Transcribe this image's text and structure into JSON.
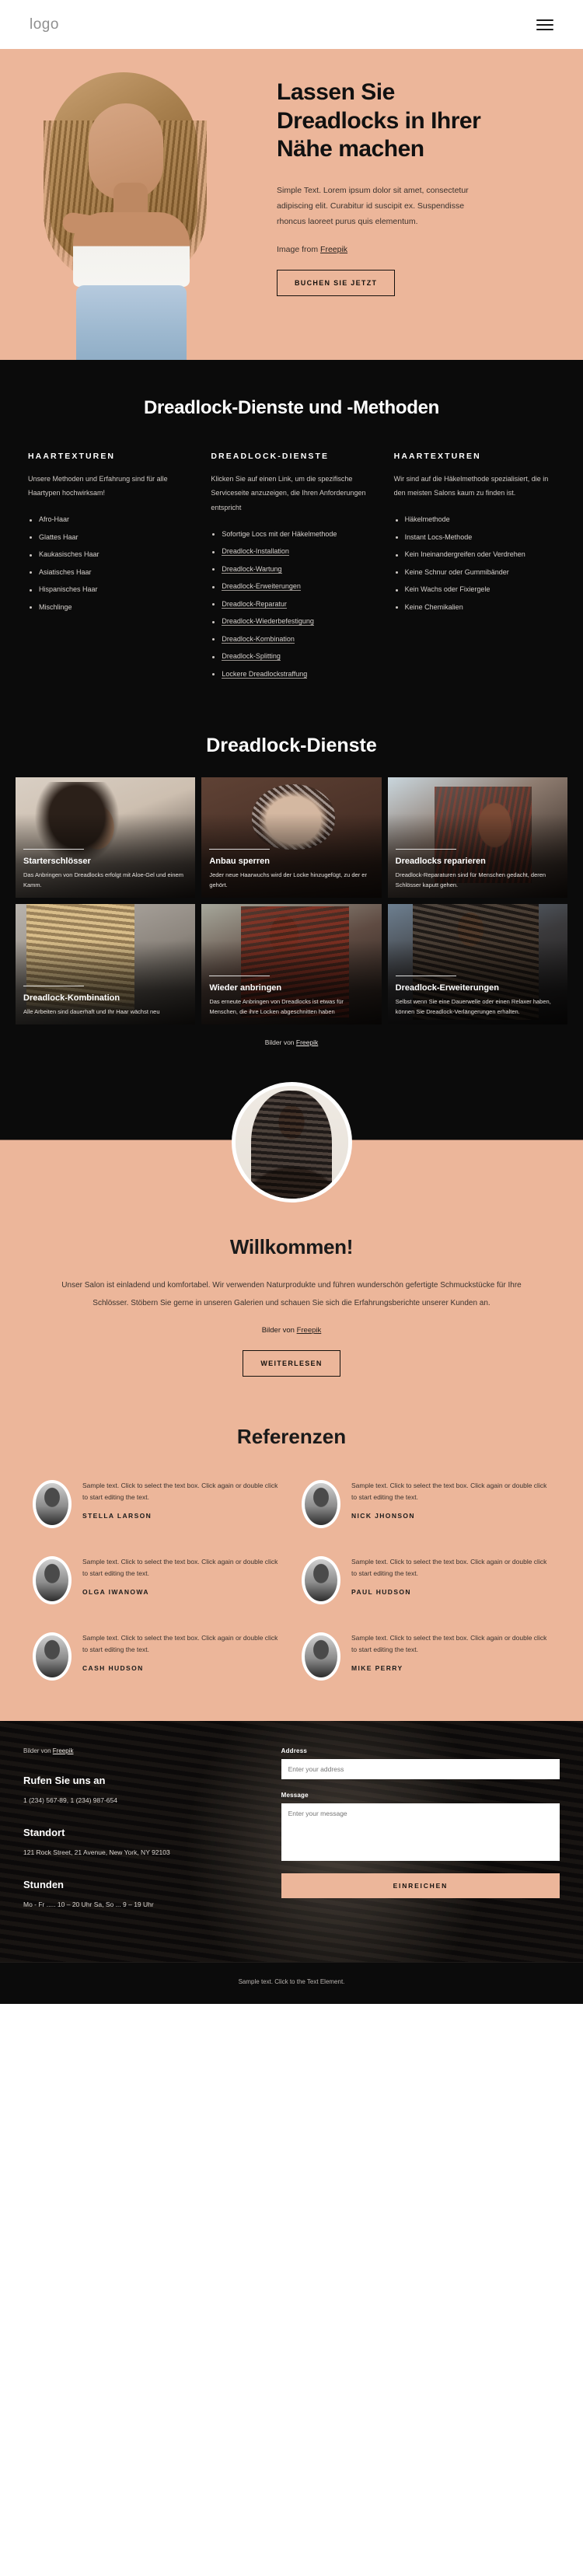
{
  "header": {
    "logo": "logo",
    "menu_icon": "hamburger-menu-icon"
  },
  "hero": {
    "title": "Lassen Sie Dreadlocks in Ihrer Nähe machen",
    "body": "Simple Text. Lorem ipsum dolor sit amet, consectetur adipiscing elit. Curabitur id suscipit ex. Suspendisse rhoncus laoreet purus quis elementum.",
    "credit_prefix": "Image from ",
    "credit_link": "Freepik",
    "cta": "BUCHEN SIE JETZT"
  },
  "methods": {
    "title": "Dreadlock-Dienste und -Methoden",
    "columns": [
      {
        "heading": "HAARTEXTUREN",
        "paragraph": "Unsere Methoden und Erfahrung sind für alle Haartypen hochwirksam!",
        "items": [
          {
            "label": "Afro-Haar",
            "link": false
          },
          {
            "label": "Glattes Haar",
            "link": false
          },
          {
            "label": "Kaukasisches Haar",
            "link": false
          },
          {
            "label": "Asiatisches Haar",
            "link": false
          },
          {
            "label": "Hispanisches Haar",
            "link": false
          },
          {
            "label": "Mischlinge",
            "link": false
          }
        ]
      },
      {
        "heading": "DREADLOCK-DIENSTE",
        "paragraph": "Klicken Sie auf einen Link, um die spezifische Serviceseite anzuzeigen, die Ihren Anforderungen entspricht",
        "items": [
          {
            "label": "Sofortige Locs mit der Häkelmethode",
            "link": false
          },
          {
            "label": "Dreadlock-Installation",
            "link": true
          },
          {
            "label": "Dreadlock-Wartung",
            "link": true
          },
          {
            "label": "Dreadlock-Erweiterungen",
            "link": true
          },
          {
            "label": "Dreadlock-Reparatur",
            "link": true
          },
          {
            "label": "Dreadlock-Wiederbefestigung",
            "link": true
          },
          {
            "label": "Dreadlock-Kombination",
            "link": true
          },
          {
            "label": "Dreadlock-Splitting",
            "link": true
          },
          {
            "label": "Lockere Dreadlockstraffung",
            "link": true
          }
        ]
      },
      {
        "heading": "HAARTEXTUREN",
        "paragraph": "Wir sind auf die Häkelmethode spezialisiert, die in den meisten Salons kaum zu finden ist.",
        "items": [
          {
            "label": "Häkelmethode",
            "link": false
          },
          {
            "label": "Instant Locs-Methode",
            "link": false
          },
          {
            "label": "Kein Ineinandergreifen oder Verdrehen",
            "link": false
          },
          {
            "label": "Keine Schnur oder Gummibänder",
            "link": false
          },
          {
            "label": "Kein Wachs oder Fixiergele",
            "link": false
          },
          {
            "label": "Keine Chemikalien",
            "link": false
          }
        ]
      }
    ]
  },
  "gallery": {
    "title": "Dreadlock-Dienste",
    "cards": [
      {
        "title": "Starterschlösser",
        "text": "Das Anbringen von Dreadlocks erfolgt mit Aloe-Gel und einem Kamm."
      },
      {
        "title": "Anbau sperren",
        "text": "Jeder neue Haarwuchs wird der Locke hinzugefügt, zu der er gehört."
      },
      {
        "title": "Dreadlocks reparieren",
        "text": "Dreadlock-Reparaturen sind für Menschen gedacht, deren Schlösser kaputt gehen."
      },
      {
        "title": "Dreadlock-Kombination",
        "text": "Alle Arbeiten sind dauerhaft und Ihr Haar wächst neu"
      },
      {
        "title": "Wieder anbringen",
        "text": "Das erneute Anbringen von Dreadlocks ist etwas für Menschen, die ihre Locken abgeschnitten haben"
      },
      {
        "title": "Dreadlock-Erweiterungen",
        "text": "Selbst wenn Sie eine Dauerwelle oder einen Relaxer haben, können Sie Dreadlock-Verlängerungen erhalten."
      }
    ],
    "credit_prefix": "Bilder von ",
    "credit_link": "Freepik"
  },
  "welcome": {
    "title": "Willkommen!",
    "body": "Unser Salon ist einladend und komfortabel. Wir verwenden Naturprodukte und führen wunderschön gefertigte Schmuckstücke für Ihre Schlösser. Stöbern Sie gerne in unseren Galerien und schauen Sie sich die Erfahrungsberichte unserer Kunden an.",
    "credit_prefix": "Bilder von ",
    "credit_link": "Freepik",
    "cta": "WEITERLESEN"
  },
  "testimonials": {
    "title": "Referenzen",
    "items": [
      {
        "text": "Sample text. Click to select the text box. Click again or double click to start editing the text.",
        "name": "STELLA LARSON"
      },
      {
        "text": "Sample text. Click to select the text box. Click again or double click to start editing the text.",
        "name": "NICK JHONSON"
      },
      {
        "text": "Sample text. Click to select the text box. Click again or double click to start editing the text.",
        "name": "OLGA IWANOWA"
      },
      {
        "text": "Sample text. Click to select the text box. Click again or double click to start editing the text.",
        "name": "PAUL HUDSON"
      },
      {
        "text": "Sample text. Click to select the text box. Click again or double click to start editing the text.",
        "name": "CASH HUDSON"
      },
      {
        "text": "Sample text. Click to select the text box. Click again or double click to start editing the text.",
        "name": "MIKE PERRY"
      }
    ]
  },
  "footer": {
    "credit_prefix": "Bilder von ",
    "credit_link": "Freepik",
    "call_heading": "Rufen Sie uns an",
    "call_text": "1 (234) 567-89, 1 (234) 987-654",
    "location_heading": "Standort",
    "location_text": "121 Rock Street, 21 Avenue, New York, NY 92103",
    "hours_heading": "Stunden",
    "hours_text": "Mo - Fr ..... 10 – 20 Uhr Sa, So ... 9 – 19 Uhr",
    "address_label": "Address",
    "address_placeholder": "Enter your address",
    "message_label": "Message",
    "message_placeholder": "Enter your message",
    "submit": "EINREICHEN"
  },
  "bottom": {
    "text": "Sample text. Click to the Text Element."
  },
  "colors": {
    "accent": "#ecb69a",
    "dark": "#0b0b0b",
    "text_dark": "#1a1a1a"
  }
}
